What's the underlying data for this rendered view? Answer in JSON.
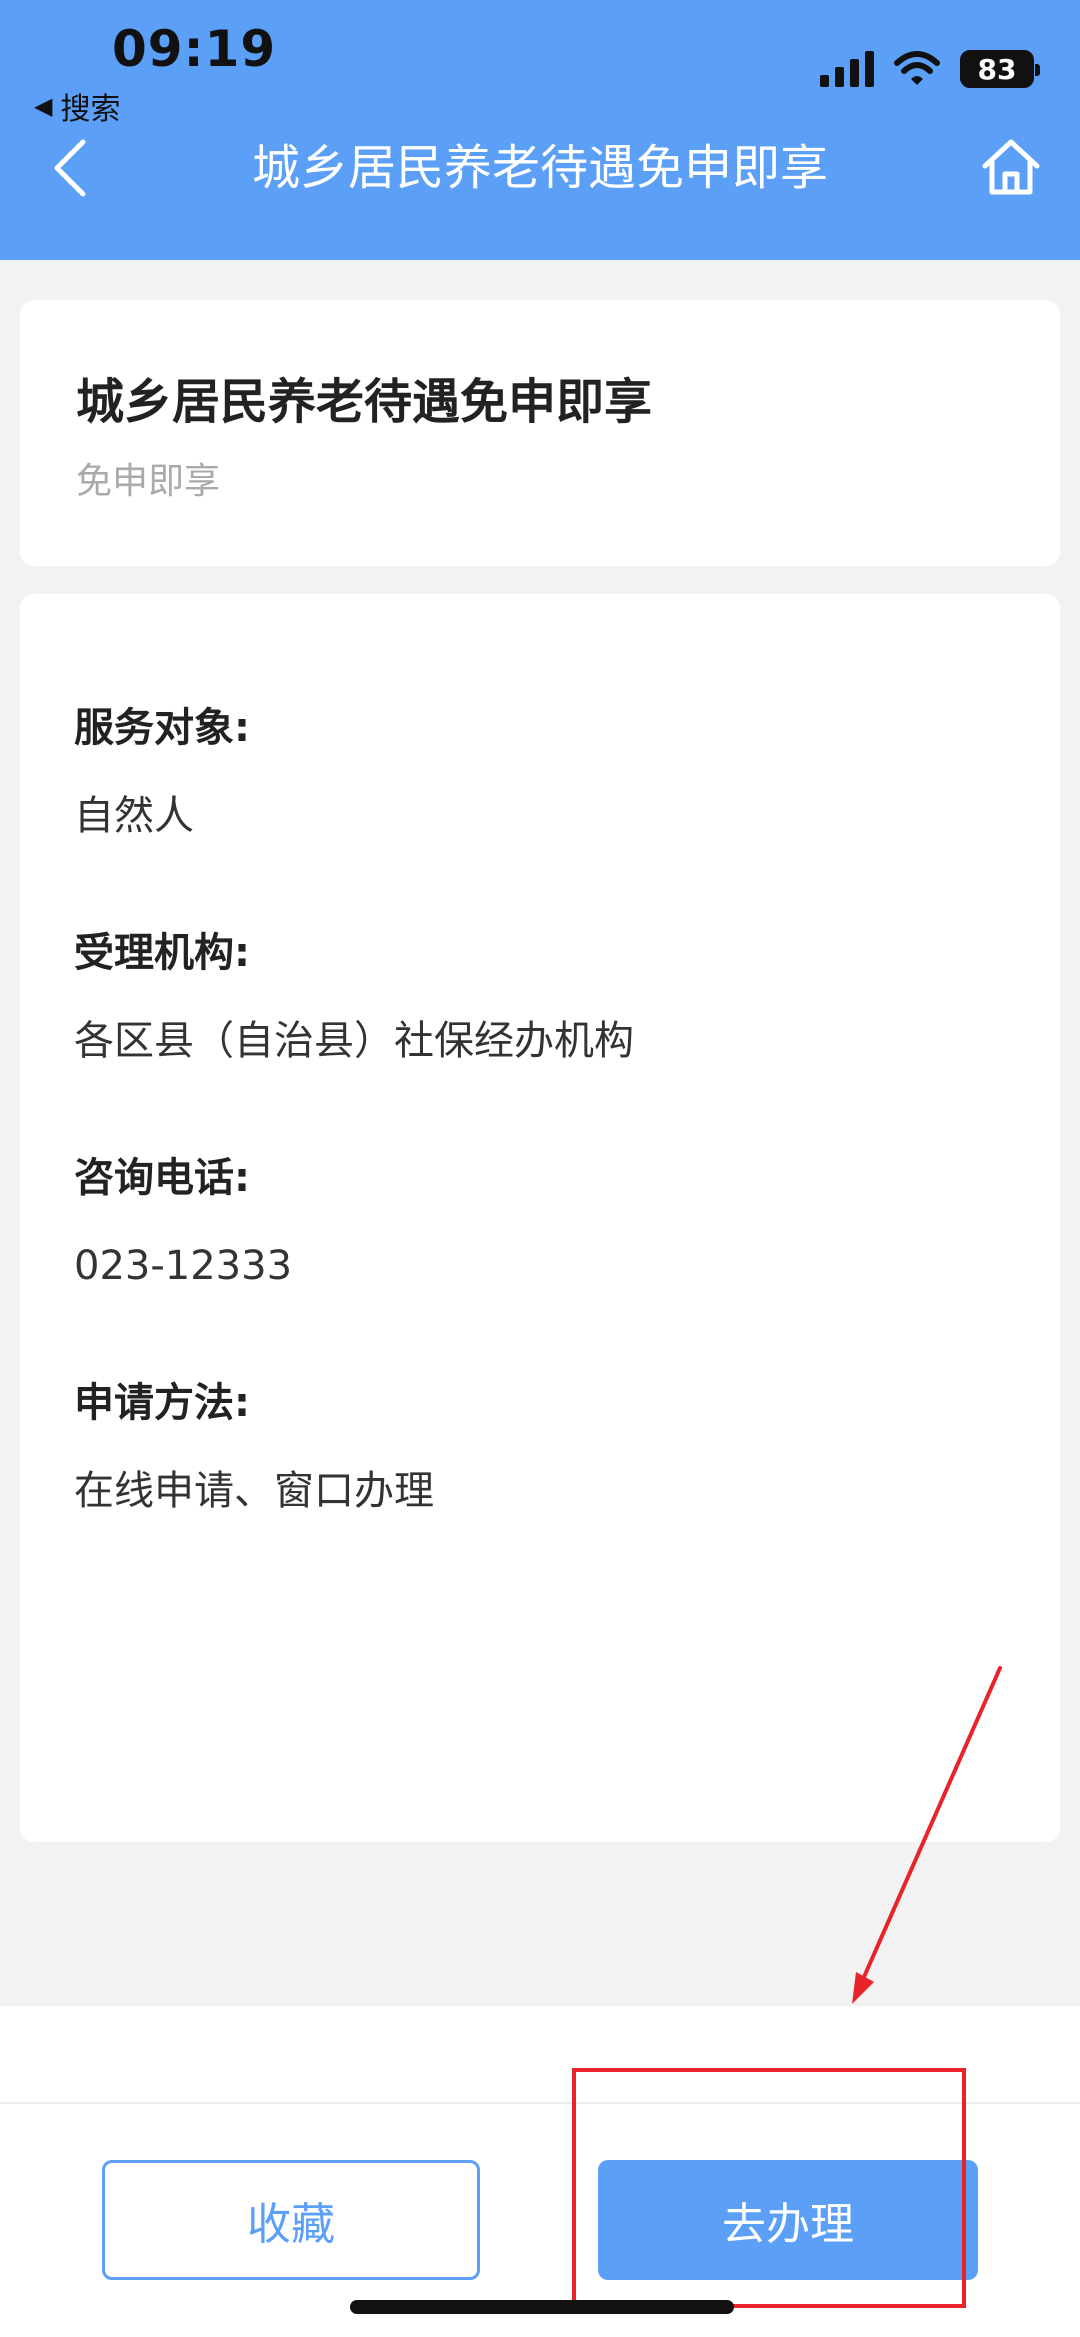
{
  "status_bar": {
    "time": "09:19",
    "back_app": "搜索",
    "battery": "83"
  },
  "nav": {
    "title": "城乡居民养老待遇免申即享"
  },
  "service": {
    "title": "城乡居民养老待遇免申即享",
    "subtitle": "免申即享"
  },
  "info": [
    {
      "label": "服务对象:",
      "value": "自然人"
    },
    {
      "label": "受理机构:",
      "value": "各区县（自治县）社保经办机构"
    },
    {
      "label": "咨询电话:",
      "value": "023-12333"
    },
    {
      "label": "申请方法:",
      "value": "在线申请、窗口办理"
    }
  ],
  "actions": {
    "favorite": "收藏",
    "handle": "去办理"
  },
  "colors": {
    "primary": "#5b9ff7",
    "annotation": "#e8232a"
  }
}
